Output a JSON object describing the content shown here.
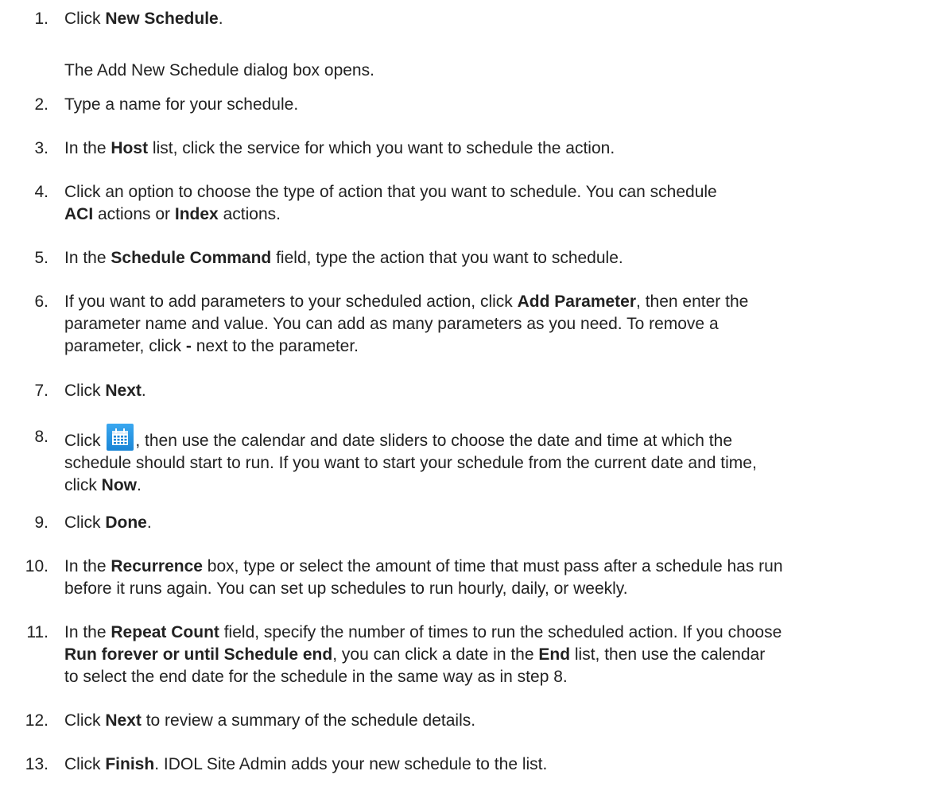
{
  "steps": [
    {
      "num": "1.",
      "lines": [
        [
          {
            "t": "Click "
          },
          {
            "t": "New Schedule",
            "b": true
          },
          {
            "t": "."
          }
        ]
      ]
    },
    {
      "num": "2.",
      "lines": [
        [
          {
            "t": "Type a name for your schedule."
          }
        ]
      ]
    },
    {
      "num": "3.",
      "lines": [
        [
          {
            "t": "In the "
          },
          {
            "t": "Host",
            "b": true
          },
          {
            "t": " list, click the service for which you want to schedule the action."
          }
        ]
      ]
    },
    {
      "num": "4.",
      "lines": [
        [
          {
            "t": "Click an option to choose the type of action that you want to schedule. You can schedule"
          }
        ],
        [
          {
            "t": "ACI",
            "b": true
          },
          {
            "t": " actions or "
          },
          {
            "t": "Index",
            "b": true
          },
          {
            "t": " actions."
          }
        ]
      ]
    },
    {
      "num": "5.",
      "lines": [
        [
          {
            "t": "In the "
          },
          {
            "t": "Schedule Command",
            "b": true
          },
          {
            "t": " field, type the action that you want to schedule."
          }
        ]
      ]
    },
    {
      "num": "6.",
      "lines": [
        [
          {
            "t": "If you want to add parameters to your scheduled action, click "
          },
          {
            "t": "Add Parameter",
            "b": true
          },
          {
            "t": ", then enter the"
          }
        ],
        [
          {
            "t": "parameter name and value. You can add as many parameters as you need. To remove a"
          }
        ],
        [
          {
            "t": "parameter, click "
          },
          {
            "t": "-",
            "b": true
          },
          {
            "t": " next to the parameter."
          }
        ]
      ]
    },
    {
      "num": "7.",
      "lines": [
        [
          {
            "t": "Click "
          },
          {
            "t": "Next",
            "b": true
          },
          {
            "t": "."
          }
        ]
      ]
    },
    {
      "num": "8.",
      "lines": [
        [
          {
            "t": "Click "
          },
          {
            "icon": "calendar-icon"
          },
          {
            "t": ", then use the calendar and date sliders to choose the date and time at which the"
          }
        ],
        [
          {
            "t": "schedule should start to run. If you want to start your schedule from the current date and time,"
          }
        ],
        [
          {
            "t": "click "
          },
          {
            "t": "Now",
            "b": true
          },
          {
            "t": "."
          }
        ]
      ]
    },
    {
      "num": "9.",
      "lines": [
        [
          {
            "t": "Click "
          },
          {
            "t": "Done",
            "b": true
          },
          {
            "t": "."
          }
        ]
      ]
    },
    {
      "num": "10.",
      "lines": [
        [
          {
            "t": "In the "
          },
          {
            "t": "Recurrence",
            "b": true
          },
          {
            "t": " box, type or select the amount of time that must pass after a schedule has run"
          }
        ],
        [
          {
            "t": "before it runs again. You can set up schedules to run hourly, daily, or weekly."
          }
        ]
      ]
    },
    {
      "num": "11.",
      "lines": [
        [
          {
            "t": "In the "
          },
          {
            "t": "Repeat Count",
            "b": true
          },
          {
            "t": " field, specify the number of times to run the scheduled action. If you choose"
          }
        ],
        [
          {
            "t": "Run forever or until Schedule end",
            "b": true
          },
          {
            "t": ", you can click a date in the "
          },
          {
            "t": "End",
            "b": true
          },
          {
            "t": " list, then use the calendar"
          }
        ],
        [
          {
            "t": "to select the end date for the schedule in the same way as in step 8."
          }
        ]
      ]
    },
    {
      "num": "12.",
      "lines": [
        [
          {
            "t": "Click "
          },
          {
            "t": "Next",
            "b": true
          },
          {
            "t": " to review a summary of the schedule details."
          }
        ]
      ]
    },
    {
      "num": "13.",
      "lines": [
        [
          {
            "t": "Click "
          },
          {
            "t": "Finish",
            "b": true
          },
          {
            "t": ". IDOL Site Admin adds your new schedule to the list."
          }
        ]
      ]
    }
  ],
  "step1_note": "The Add New Schedule dialog box opens.",
  "colors": {
    "text": "#222222",
    "icon_blue": "#1b86d6"
  }
}
